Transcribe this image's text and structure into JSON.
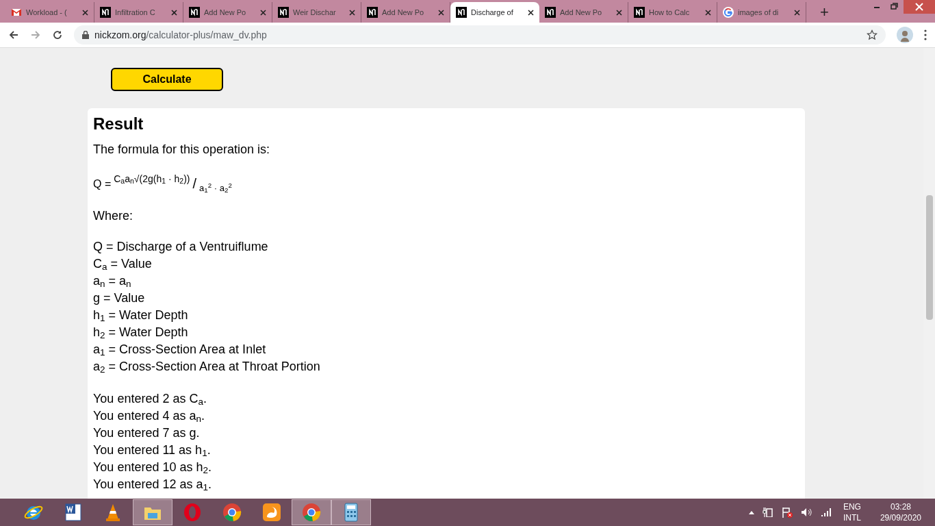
{
  "browser": {
    "tabs": [
      {
        "kind": "gmail",
        "title": "Workload - (",
        "selected": false
      },
      {
        "kind": "nickzom",
        "title": "Infiltration C",
        "selected": false
      },
      {
        "kind": "nickzom",
        "title": "Add New Po",
        "selected": false
      },
      {
        "kind": "nickzom",
        "title": "Weir Dischar",
        "selected": false
      },
      {
        "kind": "nickzom",
        "title": "Add New Po",
        "selected": false
      },
      {
        "kind": "nickzom",
        "title": "Discharge of",
        "selected": true
      },
      {
        "kind": "nickzom",
        "title": "Add New Po",
        "selected": false
      },
      {
        "kind": "nickzom",
        "title": "How to Calc",
        "selected": false
      },
      {
        "kind": "google",
        "title": "images of di",
        "selected": false
      }
    ],
    "new_tab": "+",
    "url_host": "nickzom.org",
    "url_path": "/calculator-plus/maw_dv.php"
  },
  "page": {
    "calculate_button": "Calculate",
    "result": {
      "heading": "Result",
      "intro": "The formula for this operation is:",
      "formula": {
        "lhs": "Q =",
        "numerator": "C$_{a}$a$_{n}$√(2g(h$_{1}$ · h$_{2}$))",
        "slash": "/",
        "denominator": "a$_{1}$$^{2}$ · a$_{2}$$^{2}$"
      },
      "where": "Where:",
      "definitions": [
        "Q = Discharge of a Ventruiflume",
        "C$_{a}$ = Value",
        "a$_{n}$ = a$_{n}$",
        "g = Value",
        "h$_{1}$ = Water Depth",
        "h$_{2}$ = Water Depth",
        "a$_{1}$ = Cross-Section Area at Inlet",
        "a$_{2}$ = Cross-Section Area at Throat Portion"
      ],
      "entered": [
        "You entered 2 as C$_{a}$.",
        "You entered 4 as a$_{n}$.",
        "You entered 7 as g.",
        "You entered 11 as h$_{1}$.",
        "You entered 10 as h$_{2}$.",
        "You entered 12 as a$_{1}$."
      ]
    }
  },
  "taskbar": {
    "apps": [
      {
        "kind": "ie",
        "active": false
      },
      {
        "kind": "word",
        "active": false
      },
      {
        "kind": "vlc",
        "active": false
      },
      {
        "kind": "explorer",
        "active": true
      },
      {
        "kind": "opera",
        "active": false
      },
      {
        "kind": "chrome",
        "active": false
      },
      {
        "kind": "ucbrowser",
        "active": false
      },
      {
        "kind": "chrome",
        "active": true
      },
      {
        "kind": "calculator",
        "active": true
      }
    ],
    "language": "ENG",
    "layout": "INTL",
    "time": "03:28",
    "date": "29/09/2020"
  }
}
